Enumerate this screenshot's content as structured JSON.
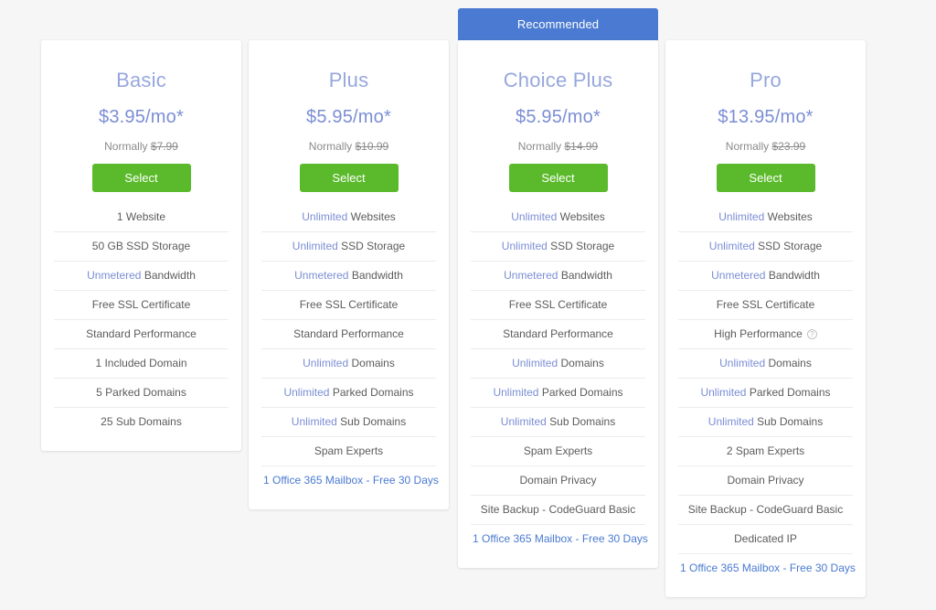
{
  "banner": {
    "recommended_label": "Recommended"
  },
  "help_icon_glyph": "?",
  "colors": {
    "page_background": "#f6f6f6",
    "card_background": "#ffffff",
    "plan_name": "#97a7de",
    "plan_price": "#7b8ed5",
    "highlight_text": "#7b8ed5",
    "link_text": "#4a7ad1",
    "select_button": "#5bba2b",
    "banner": "#4a7ad1",
    "feature_text": "#5c5c5c",
    "divider": "#ececec"
  },
  "plans": [
    {
      "id": "basic",
      "name": "Basic",
      "price": "$3.95/mo*",
      "normally_label": "Normally",
      "normally_price": "$7.99",
      "select_label": "Select",
      "recommended": false,
      "features": [
        {
          "prefix": "",
          "text": "1 Website",
          "link": false
        },
        {
          "prefix": "",
          "text": "50 GB SSD Storage",
          "link": false
        },
        {
          "prefix": "Unmetered",
          "text": "Bandwidth",
          "link": false
        },
        {
          "prefix": "",
          "text": "Free SSL Certificate",
          "link": false
        },
        {
          "prefix": "",
          "text": "Standard Performance",
          "link": false
        },
        {
          "prefix": "",
          "text": "1 Included Domain",
          "link": false
        },
        {
          "prefix": "",
          "text": "5 Parked Domains",
          "link": false
        },
        {
          "prefix": "",
          "text": "25 Sub Domains",
          "link": false
        }
      ]
    },
    {
      "id": "plus",
      "name": "Plus",
      "price": "$5.95/mo*",
      "normally_label": "Normally",
      "normally_price": "$10.99",
      "select_label": "Select",
      "recommended": false,
      "features": [
        {
          "prefix": "Unlimited",
          "text": "Websites",
          "link": false
        },
        {
          "prefix": "Unlimited",
          "text": "SSD Storage",
          "link": false
        },
        {
          "prefix": "Unmetered",
          "text": "Bandwidth",
          "link": false
        },
        {
          "prefix": "",
          "text": "Free SSL Certificate",
          "link": false
        },
        {
          "prefix": "",
          "text": "Standard Performance",
          "link": false
        },
        {
          "prefix": "Unlimited",
          "text": "Domains",
          "link": false
        },
        {
          "prefix": "Unlimited",
          "text": "Parked Domains",
          "link": false
        },
        {
          "prefix": "Unlimited",
          "text": "Sub Domains",
          "link": false
        },
        {
          "prefix": "",
          "text": "Spam Experts",
          "link": false
        },
        {
          "prefix": "",
          "text": "1 Office 365 Mailbox - Free 30 Days",
          "link": true
        }
      ]
    },
    {
      "id": "choiceplus",
      "name": "Choice Plus",
      "price": "$5.95/mo*",
      "normally_label": "Normally",
      "normally_price": "$14.99",
      "select_label": "Select",
      "recommended": true,
      "features": [
        {
          "prefix": "Unlimited",
          "text": "Websites",
          "link": false
        },
        {
          "prefix": "Unlimited",
          "text": "SSD Storage",
          "link": false
        },
        {
          "prefix": "Unmetered",
          "text": "Bandwidth",
          "link": false
        },
        {
          "prefix": "",
          "text": "Free SSL Certificate",
          "link": false
        },
        {
          "prefix": "",
          "text": "Standard Performance",
          "link": false
        },
        {
          "prefix": "Unlimited",
          "text": "Domains",
          "link": false
        },
        {
          "prefix": "Unlimited",
          "text": "Parked Domains",
          "link": false
        },
        {
          "prefix": "Unlimited",
          "text": "Sub Domains",
          "link": false
        },
        {
          "prefix": "",
          "text": "Spam Experts",
          "link": false
        },
        {
          "prefix": "",
          "text": "Domain Privacy",
          "link": false
        },
        {
          "prefix": "",
          "text": "Site Backup - CodeGuard Basic",
          "link": false
        },
        {
          "prefix": "",
          "text": "1 Office 365 Mailbox - Free 30 Days",
          "link": true
        }
      ]
    },
    {
      "id": "pro",
      "name": "Pro",
      "price": "$13.95/mo*",
      "normally_label": "Normally",
      "normally_price": "$23.99",
      "select_label": "Select",
      "recommended": false,
      "features": [
        {
          "prefix": "Unlimited",
          "text": "Websites",
          "link": false
        },
        {
          "prefix": "Unlimited",
          "text": "SSD Storage",
          "link": false
        },
        {
          "prefix": "Unmetered",
          "text": "Bandwidth",
          "link": false
        },
        {
          "prefix": "",
          "text": "Free SSL Certificate",
          "link": false
        },
        {
          "prefix": "",
          "text": "High Performance",
          "link": false,
          "help": true
        },
        {
          "prefix": "Unlimited",
          "text": "Domains",
          "link": false
        },
        {
          "prefix": "Unlimited",
          "text": "Parked Domains",
          "link": false
        },
        {
          "prefix": "Unlimited",
          "text": "Sub Domains",
          "link": false
        },
        {
          "prefix": "",
          "text": "2 Spam Experts",
          "link": false
        },
        {
          "prefix": "",
          "text": "Domain Privacy",
          "link": false
        },
        {
          "prefix": "",
          "text": "Site Backup - CodeGuard Basic",
          "link": false
        },
        {
          "prefix": "",
          "text": "Dedicated IP",
          "link": false
        },
        {
          "prefix": "",
          "text": "1 Office 365 Mailbox - Free 30 Days",
          "link": true
        }
      ]
    }
  ]
}
